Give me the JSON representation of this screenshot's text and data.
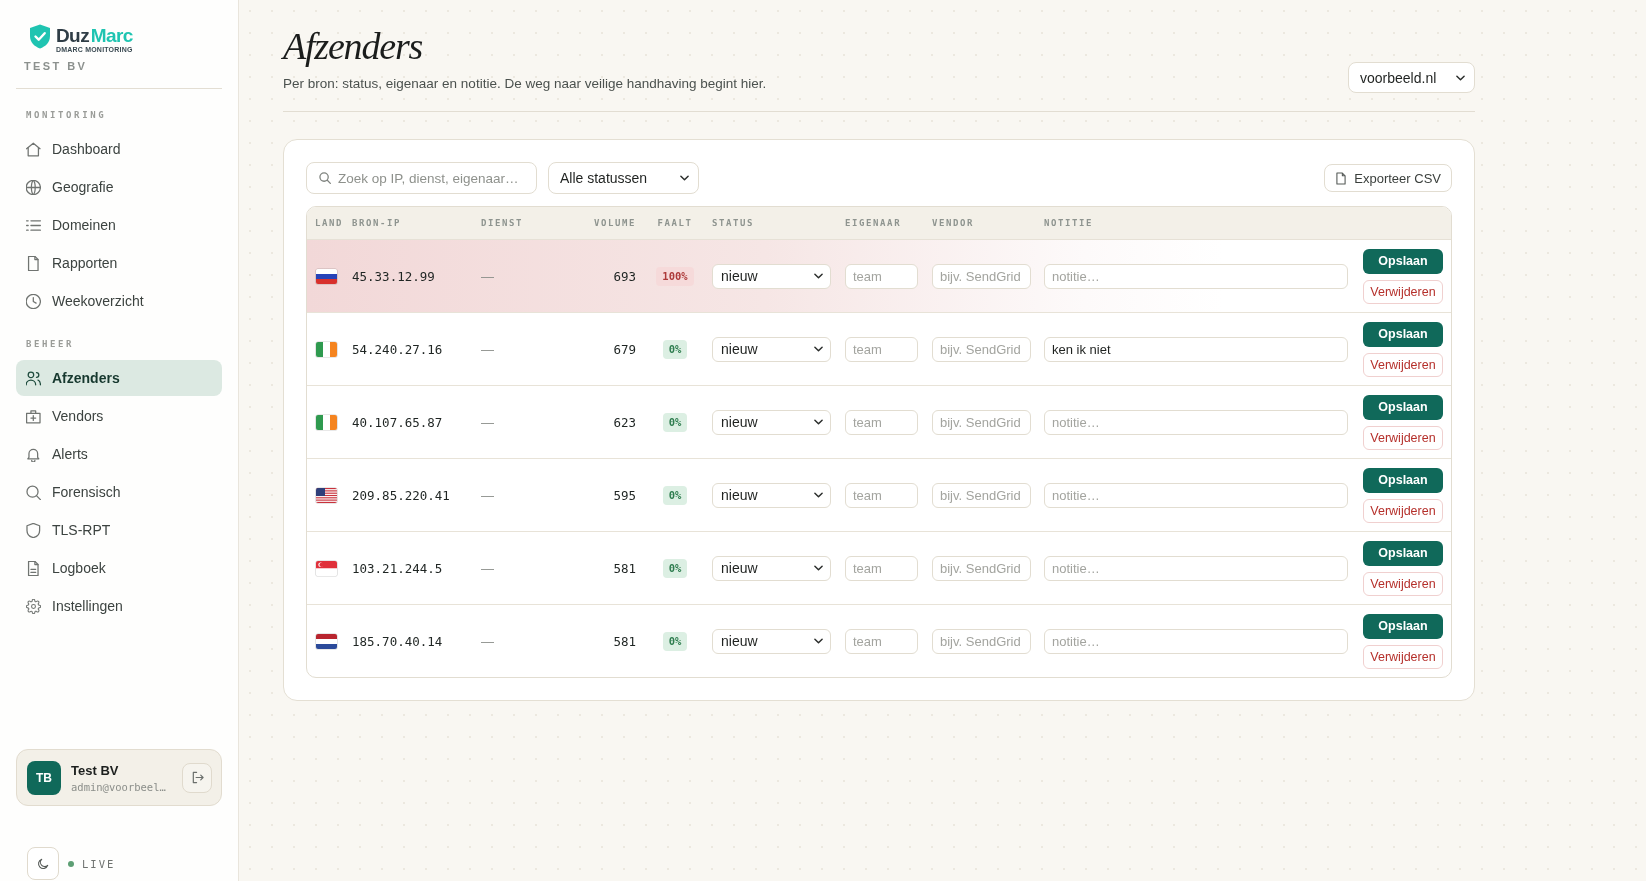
{
  "sidebar": {
    "logo": {
      "brand_first": "Duz",
      "brand_second": "Marc",
      "tagline": "DMARC MONITORING"
    },
    "organization": "TEST BV",
    "sections": [
      {
        "title": "MONITORING",
        "items": [
          {
            "label": "Dashboard",
            "selected": false
          },
          {
            "label": "Geografie",
            "selected": false
          },
          {
            "label": "Domeinen",
            "selected": false
          },
          {
            "label": "Rapporten",
            "selected": false
          },
          {
            "label": "Weekoverzicht",
            "selected": false
          }
        ]
      },
      {
        "title": "BEHEER",
        "items": [
          {
            "label": "Afzenders",
            "selected": true
          },
          {
            "label": "Vendors",
            "selected": false
          },
          {
            "label": "Alerts",
            "selected": false
          },
          {
            "label": "Forensisch",
            "selected": false
          },
          {
            "label": "TLS-RPT",
            "selected": false
          },
          {
            "label": "Logboek",
            "selected": false
          },
          {
            "label": "Instellingen",
            "selected": false
          }
        ]
      }
    ],
    "user": {
      "initials": "TB",
      "name": "Test BV",
      "email": "admin@voorbeel…"
    },
    "live_status": {
      "label": "LIVE"
    }
  },
  "header": {
    "title": "Afzenders",
    "subtitle": "Per bron: status, eigenaar en notitie. De weg naar veilige handhaving begint hier.",
    "domain_select": {
      "value": "voorbeeld.nl"
    }
  },
  "toolbar": {
    "search": {
      "placeholder": "Zoek op IP, dienst, eigenaar…"
    },
    "status_filter": {
      "value": "Alle statussen"
    },
    "export_button": {
      "label": "Exporteer CSV"
    }
  },
  "table": {
    "columns": [
      "LAND",
      "BRON-IP",
      "DIENST",
      "VOLUME",
      "FAALT",
      "STATUS",
      "EIGENAAR",
      "VENDOR",
      "NOTITIE"
    ],
    "rows": [
      {
        "flag": {
          "kind": "RU"
        },
        "ip": "45.33.12.99",
        "service": "—",
        "volume": "693",
        "fail_rate": "100%",
        "failing": true,
        "status": "nieuw",
        "owner": {
          "placeholder": "team"
        },
        "vendor": {
          "placeholder": "bijv. SendGrid"
        },
        "note": {
          "placeholder": "notitie…"
        },
        "save_label": "Opslaan",
        "delete_label": "Verwijderen"
      },
      {
        "flag": {
          "kind": "IE"
        },
        "ip": "54.240.27.16",
        "service": "—",
        "volume": "679",
        "fail_rate": "0%",
        "failing": false,
        "status": "nieuw",
        "owner": {
          "placeholder": "team"
        },
        "vendor": {
          "placeholder": "bijv. SendGrid"
        },
        "note": {
          "value": "ken ik niet"
        },
        "save_label": "Opslaan",
        "delete_label": "Verwijderen"
      },
      {
        "flag": {
          "kind": "IE"
        },
        "ip": "40.107.65.87",
        "service": "—",
        "volume": "623",
        "fail_rate": "0%",
        "failing": false,
        "status": "nieuw",
        "owner": {
          "placeholder": "team"
        },
        "vendor": {
          "placeholder": "bijv. SendGrid"
        },
        "note": {
          "placeholder": "notitie…"
        },
        "save_label": "Opslaan",
        "delete_label": "Verwijderen"
      },
      {
        "flag": {
          "kind": "US"
        },
        "ip": "209.85.220.41",
        "service": "—",
        "volume": "595",
        "fail_rate": "0%",
        "failing": false,
        "status": "nieuw",
        "owner": {
          "placeholder": "team"
        },
        "vendor": {
          "placeholder": "bijv. SendGrid"
        },
        "note": {
          "placeholder": "notitie…"
        },
        "save_label": "Opslaan",
        "delete_label": "Verwijderen"
      },
      {
        "flag": {
          "kind": "SG"
        },
        "ip": "103.21.244.5",
        "service": "—",
        "volume": "581",
        "fail_rate": "0%",
        "failing": false,
        "status": "nieuw",
        "owner": {
          "placeholder": "team"
        },
        "vendor": {
          "placeholder": "bijv. SendGrid"
        },
        "note": {
          "placeholder": "notitie…"
        },
        "save_label": "Opslaan",
        "delete_label": "Verwijderen"
      },
      {
        "flag": {
          "kind": "NL"
        },
        "ip": "185.70.40.14",
        "service": "—",
        "volume": "581",
        "fail_rate": "0%",
        "failing": false,
        "status": "nieuw",
        "owner": {
          "placeholder": "team"
        },
        "vendor": {
          "placeholder": "bijv. SendGrid"
        },
        "note": {
          "placeholder": "notitie…"
        },
        "save_label": "Opslaan",
        "delete_label": "Verwijderen"
      }
    ]
  }
}
